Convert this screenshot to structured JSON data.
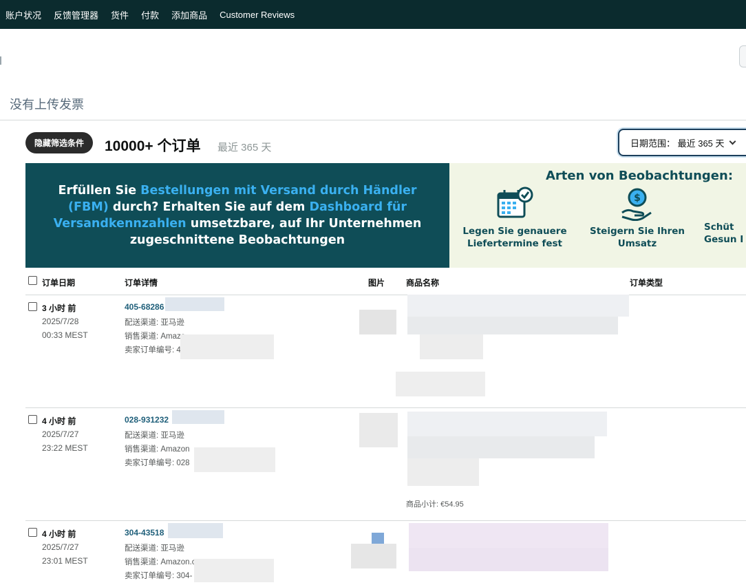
{
  "topnav": {
    "items": [
      "账户状况",
      "反馈管理器",
      "货件",
      "付款",
      "添加商品",
      "Customer Reviews"
    ]
  },
  "notice": "没有上传发票",
  "header": {
    "filter_button": "隐藏筛选条件",
    "order_count": "10000+ 个订单",
    "range": "最近 365 天",
    "date_select": "日期范围： 最近 365 天"
  },
  "banner": {
    "lead_1": "Erfüllen Sie ",
    "link_1": "Bestellungen mit Versand durch Händler (FBM)",
    "lead_2": " durch? Erhalten Sie auf dem ",
    "link_2": "Dashboard für Versandkennzahlen",
    "lead_3": " umsetzbare, auf Ihr Unternehmen zugeschnittene Beobachtungen",
    "right_title": "Arten von Beobachtungen:",
    "observations": [
      {
        "icon": "calendar-check-icon",
        "label": "Legen Sie genauere Liefertermine fest"
      },
      {
        "icon": "dollar-hand-icon",
        "label": "Steigern Sie Ihren Umsatz"
      },
      {
        "icon": "shield-icon",
        "label": "Schüt Gesun I"
      }
    ]
  },
  "table": {
    "headers": {
      "date": "订单日期",
      "details": "订单详情",
      "image": "图片",
      "name": "商品名称",
      "type": "订单类型"
    },
    "rows": [
      {
        "ago": "3 小时 前",
        "date": "2025/7/28",
        "time": "00:33 MEST",
        "order_id": "405-68286",
        "channel_label": "配送渠道: 亚马逊",
        "sales_label": "销售渠道: Amazo",
        "seller_order": "卖家订单编号: 4",
        "subtotal": ""
      },
      {
        "ago": "4 小时 前",
        "date": "2025/7/27",
        "time": "23:22 MEST",
        "order_id": "028-931232",
        "channel_label": "配送渠道: 亚马逊",
        "sales_label": "销售渠道: Amazon",
        "seller_order": "卖家订单编号: 028",
        "subtotal": "商品小计: €54.95"
      },
      {
        "ago": "4 小时 前",
        "date": "2025/7/27",
        "time": "23:01 MEST",
        "order_id": "304-43518",
        "channel_label": "配送渠道: 亚马逊",
        "sales_label": "销售渠道: Amazon.c",
        "seller_order": "卖家订单编号: 304-",
        "subtotal": ""
      }
    ]
  },
  "colors": {
    "nav_bg": "#0b2b2e",
    "banner_left_bg": "#0f4d57",
    "banner_right_bg": "#f1f5e5",
    "link_blue": "#3ab0f0",
    "order_id": "#1f5f7a"
  }
}
